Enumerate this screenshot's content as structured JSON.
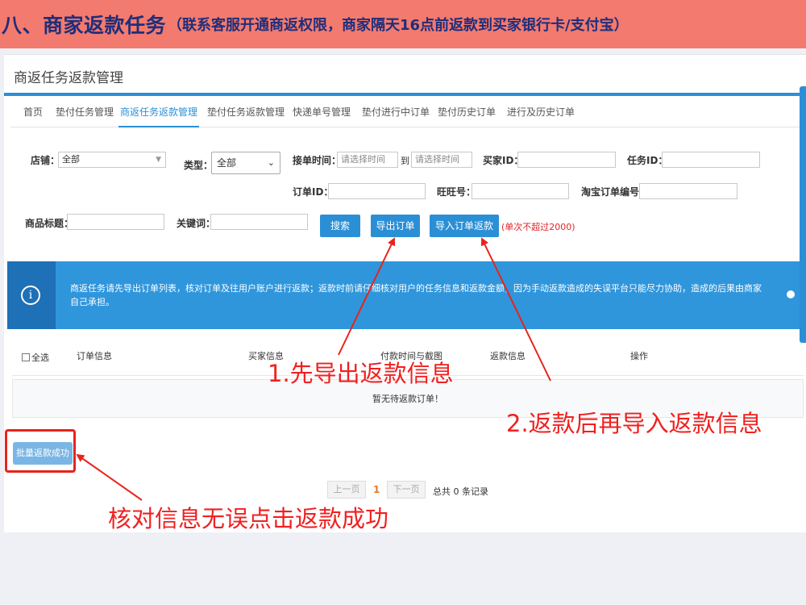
{
  "banner": {
    "title": "八、商家返款任务",
    "subtitle": "（联系客服开通商返权限，商家隔天16点前返款到买家银行卡/支付宝）"
  },
  "page": {
    "title": "商返任务返款管理"
  },
  "tabs": [
    {
      "label": "首页"
    },
    {
      "label": "垫付任务管理"
    },
    {
      "label": "商返任务返款管理",
      "active": true
    },
    {
      "label": "垫付任务返款管理"
    },
    {
      "label": "快递单号管理"
    },
    {
      "label": "垫付进行中订单"
    },
    {
      "label": "垫付历史订单"
    },
    {
      "label": "进行及历史订单"
    }
  ],
  "filters": {
    "shop_label": "店铺：",
    "shop_value": "全部",
    "type_label": "类型：",
    "type_value": "全部",
    "time_label": "接单时间：",
    "time_start_placeholder": "请选择时间",
    "time_to": "到",
    "time_end_placeholder": "请选择时间",
    "buyer_id_label": "买家ID：",
    "task_id_label": "任务ID：",
    "order_id_label": "订单ID：",
    "wangwang_label": "旺旺号：",
    "taobao_order_label": "淘宝订单编号：",
    "goods_title_label": "商品标题：",
    "keyword_label": "关键词："
  },
  "actions": {
    "search": "搜索",
    "export": "导出订单",
    "import": "导入订单返款",
    "import_note": "(单次不超过2000)"
  },
  "info": {
    "text": "商返任务请先导出订单列表，核对订单及往用户账户进行返款；返款时前请仔细核对用户的任务信息和返款金额，因为手动返款造成的失误平台只能尽力协助，造成的后果由商家自己承担。"
  },
  "table": {
    "select_all": "全选",
    "headers": [
      "订单信息",
      "买家信息",
      "付款时间与截图",
      "返款信息",
      "操作"
    ],
    "empty": "暂无待返款订单！"
  },
  "batch_button": "批量返款成功",
  "pagination": {
    "prev": "上一页",
    "current": "1",
    "next": "下一页",
    "total": "总共 0 条记录"
  },
  "annotations": {
    "step1": "1.先导出返款信息",
    "step2": "2.返款后再导入返款信息",
    "step3": "核对信息无误点击返款成功"
  },
  "colors": {
    "primary": "#2b8fd6",
    "banner": "#f37a6e",
    "annotation": "#f02020"
  }
}
